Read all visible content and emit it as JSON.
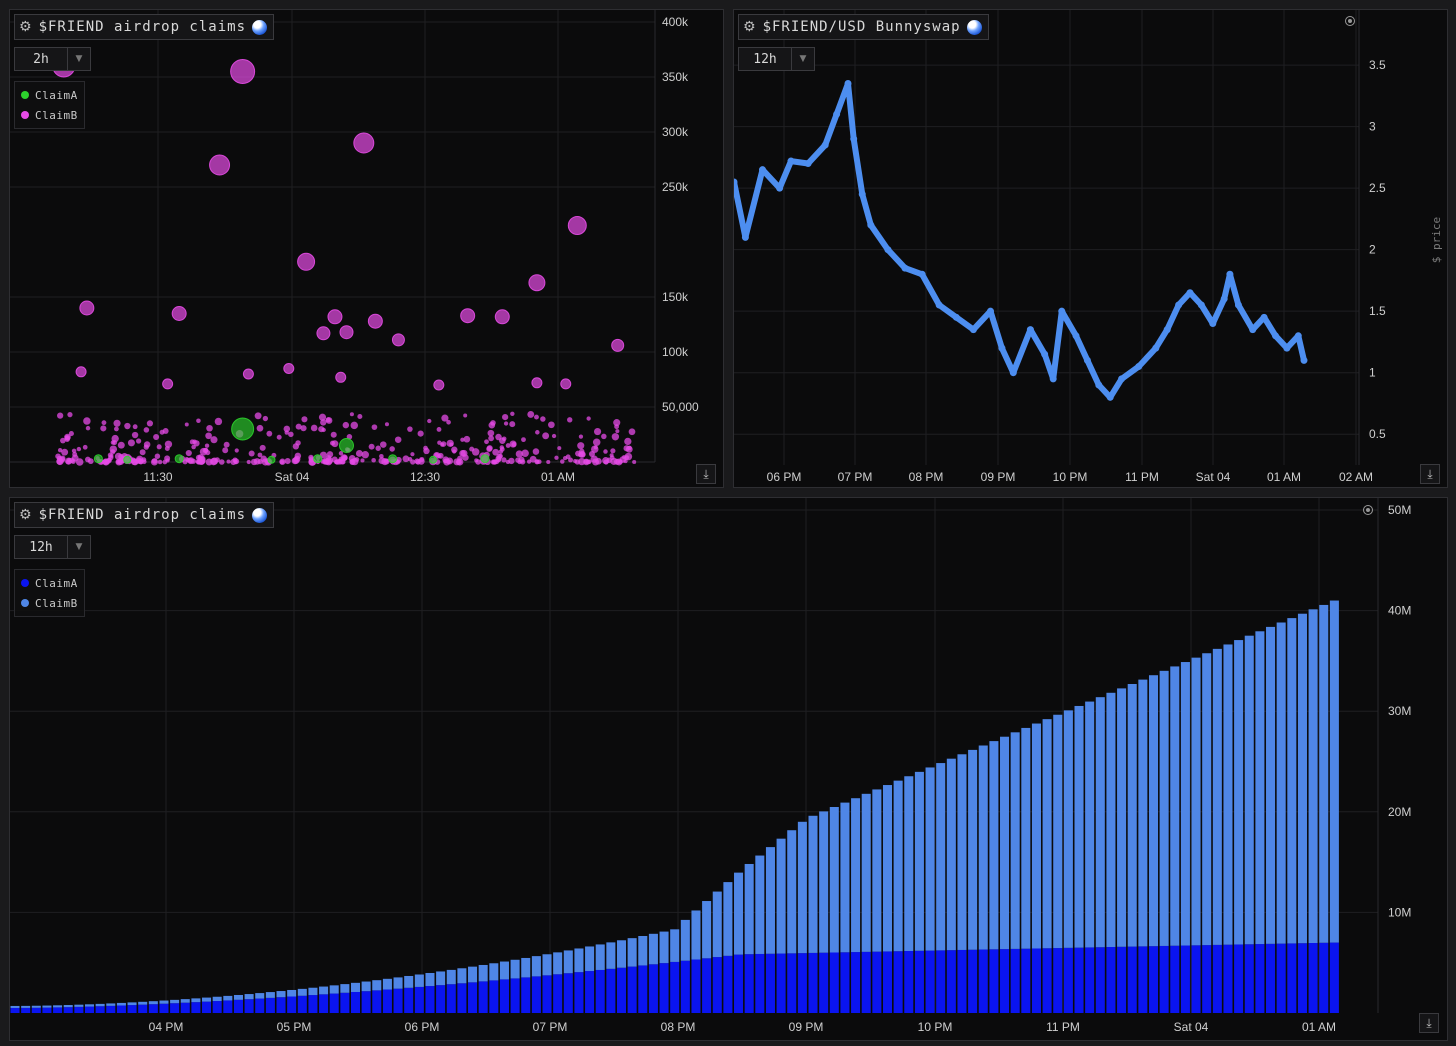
{
  "panels": [
    {
      "title": "$FRIEND airdrop claims",
      "timeframe": "2h"
    },
    {
      "title": "$FRIEND/USD Bunnyswap",
      "timeframe": "12h"
    },
    {
      "title": "$FRIEND airdrop claims",
      "timeframe": "12h"
    }
  ],
  "chart_data": [
    {
      "type": "scatter",
      "title": "$FRIEND airdrop claims",
      "legend_position": "top-left",
      "x_ticks": [
        "11:30",
        "Sat 04",
        "12:30",
        "01 AM"
      ],
      "y_ticks": [
        "50,000",
        "100k",
        "150k",
        "250k",
        "300k",
        "350k",
        "400k"
      ],
      "ylim": [
        0,
        400000
      ],
      "grid": true,
      "series": [
        {
          "name": "ClaimA",
          "color": "#2cd12c",
          "points": [
            [
              0.07,
              3000,
              8
            ],
            [
              0.12,
              2000,
              7
            ],
            [
              0.21,
              3000,
              8
            ],
            [
              0.32,
              30000,
              22
            ],
            [
              0.37,
              2000,
              7
            ],
            [
              0.45,
              3000,
              8
            ],
            [
              0.5,
              15000,
              14
            ],
            [
              0.58,
              3000,
              8
            ],
            [
              0.65,
              2000,
              7
            ],
            [
              0.74,
              3000,
              8
            ]
          ]
        },
        {
          "name": "ClaimB",
          "color": "#e64be6",
          "points": [
            [
              0.01,
              360000,
              22
            ],
            [
              0.05,
              140000,
              14
            ],
            [
              0.21,
              135000,
              14
            ],
            [
              0.28,
              270000,
              20
            ],
            [
              0.32,
              355000,
              24
            ],
            [
              0.53,
              290000,
              20
            ],
            [
              0.9,
              215000,
              18
            ],
            [
              0.43,
              182000,
              17
            ],
            [
              0.83,
              163000,
              16
            ],
            [
              0.48,
              132000,
              14
            ],
            [
              0.46,
              117000,
              13
            ],
            [
              0.5,
              118000,
              13
            ],
            [
              0.55,
              128000,
              14
            ],
            [
              0.59,
              111000,
              12
            ],
            [
              0.71,
              133000,
              14
            ],
            [
              0.77,
              132000,
              14
            ],
            [
              0.97,
              106000,
              12
            ],
            [
              0.04,
              82000,
              10
            ],
            [
              0.19,
              71000,
              10
            ],
            [
              0.33,
              80000,
              10
            ],
            [
              0.4,
              85000,
              10
            ],
            [
              0.49,
              77000,
              10
            ],
            [
              0.66,
              70000,
              10
            ],
            [
              0.83,
              72000,
              10
            ],
            [
              0.88,
              71000,
              10
            ]
          ]
        }
      ]
    },
    {
      "type": "line",
      "title": "$FRIEND/USD Bunnyswap",
      "ylabel": "$ price",
      "x_ticks": [
        "06 PM",
        "07 PM",
        "08 PM",
        "09 PM",
        "10 PM",
        "11 PM",
        "Sat 04",
        "01 AM",
        "02 AM"
      ],
      "y_ticks": [
        "0.5",
        "1",
        "1.5",
        "2",
        "2.5",
        "3",
        "3.5"
      ],
      "ylim": [
        0.25,
        3.85
      ],
      "grid": true,
      "series": [
        {
          "name": "",
          "color": "#4d8ef0",
          "points": [
            [
              0.0,
              2.55
            ],
            [
              0.02,
              2.1
            ],
            [
              0.05,
              2.65
            ],
            [
              0.08,
              2.5
            ],
            [
              0.1,
              2.72
            ],
            [
              0.13,
              2.7
            ],
            [
              0.16,
              2.85
            ],
            [
              0.18,
              3.1
            ],
            [
              0.2,
              3.35
            ],
            [
              0.21,
              2.9
            ],
            [
              0.225,
              2.45
            ],
            [
              0.24,
              2.2
            ],
            [
              0.27,
              2.0
            ],
            [
              0.3,
              1.85
            ],
            [
              0.33,
              1.8
            ],
            [
              0.36,
              1.55
            ],
            [
              0.39,
              1.45
            ],
            [
              0.42,
              1.35
            ],
            [
              0.45,
              1.5
            ],
            [
              0.47,
              1.2
            ],
            [
              0.49,
              1.0
            ],
            [
              0.52,
              1.35
            ],
            [
              0.545,
              1.15
            ],
            [
              0.56,
              0.95
            ],
            [
              0.575,
              1.5
            ],
            [
              0.6,
              1.3
            ],
            [
              0.62,
              1.1
            ],
            [
              0.64,
              0.9
            ],
            [
              0.66,
              0.8
            ],
            [
              0.68,
              0.95
            ],
            [
              0.71,
              1.05
            ],
            [
              0.74,
              1.2
            ],
            [
              0.76,
              1.35
            ],
            [
              0.78,
              1.55
            ],
            [
              0.8,
              1.65
            ],
            [
              0.82,
              1.55
            ],
            [
              0.84,
              1.4
            ],
            [
              0.86,
              1.6
            ],
            [
              0.87,
              1.8
            ],
            [
              0.885,
              1.55
            ],
            [
              0.91,
              1.35
            ],
            [
              0.93,
              1.45
            ],
            [
              0.95,
              1.3
            ],
            [
              0.97,
              1.2
            ],
            [
              0.99,
              1.3
            ],
            [
              1.0,
              1.1
            ]
          ]
        }
      ]
    },
    {
      "type": "bar",
      "stacked": true,
      "title": "$FRIEND airdrop claims",
      "legend_position": "top-left",
      "x_ticks": [
        "04 PM",
        "05 PM",
        "06 PM",
        "07 PM",
        "08 PM",
        "09 PM",
        "10 PM",
        "11 PM",
        "Sat 04",
        "01 AM"
      ],
      "y_ticks": [
        "10M",
        "20M",
        "30M",
        "40M",
        "50M"
      ],
      "ylim": [
        0,
        50000000
      ],
      "grid": true,
      "series": [
        {
          "name": "ClaimA",
          "color": "#0a14f0",
          "cumulative_start": 500000,
          "cumulative_end": 7000000,
          "bars": 125
        },
        {
          "name": "ClaimB",
          "color": "#4f86e6",
          "cumulative_start": 200000,
          "cumulative_end": 34000000,
          "bars": 125
        }
      ]
    }
  ]
}
